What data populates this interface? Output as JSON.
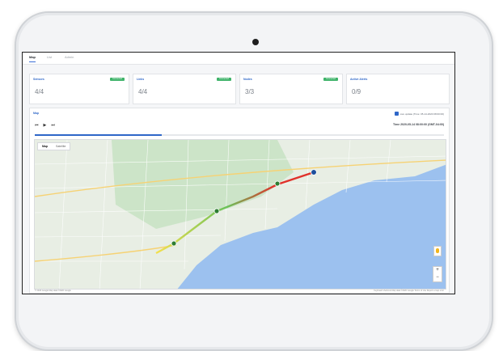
{
  "tabs": [
    {
      "label": "Map",
      "active": true
    },
    {
      "label": "List",
      "active": false
    },
    {
      "label": "Admin",
      "active": false
    }
  ],
  "cards": [
    {
      "label": "Sensors",
      "value": "4/4",
      "badge": "Connected"
    },
    {
      "label": "Links",
      "value": "4/4",
      "badge": "Connected"
    },
    {
      "label": "Nodes",
      "value": "3/3",
      "badge": "Connected"
    },
    {
      "label": "Active Alerts",
      "value": "0/9",
      "badge": ""
    }
  ],
  "map_section": {
    "title": "Map",
    "live_label": "Live update (Time: 05-14-2020 08:00:00)",
    "time_label": "Time 2020-05-14 08:00:00 (GMT-04:00)",
    "playback_progress": 0.31,
    "map_tabs": [
      "Map",
      "Satellite"
    ],
    "zoom_in": "+",
    "zoom_out": "−",
    "footer_left": "© 2020 Google  Map data ©2020 Google",
    "footer_right": "Keyboard shortcuts  Map data ©2020 Google  Terms of Use  Report a map error"
  },
  "colors": {
    "water": "#9cc1ef",
    "land": "#e8eee4",
    "park": "#c7e2c3",
    "route_start": "#f4e04d",
    "route_end": "#e0322b",
    "accent": "#2f67c8"
  }
}
